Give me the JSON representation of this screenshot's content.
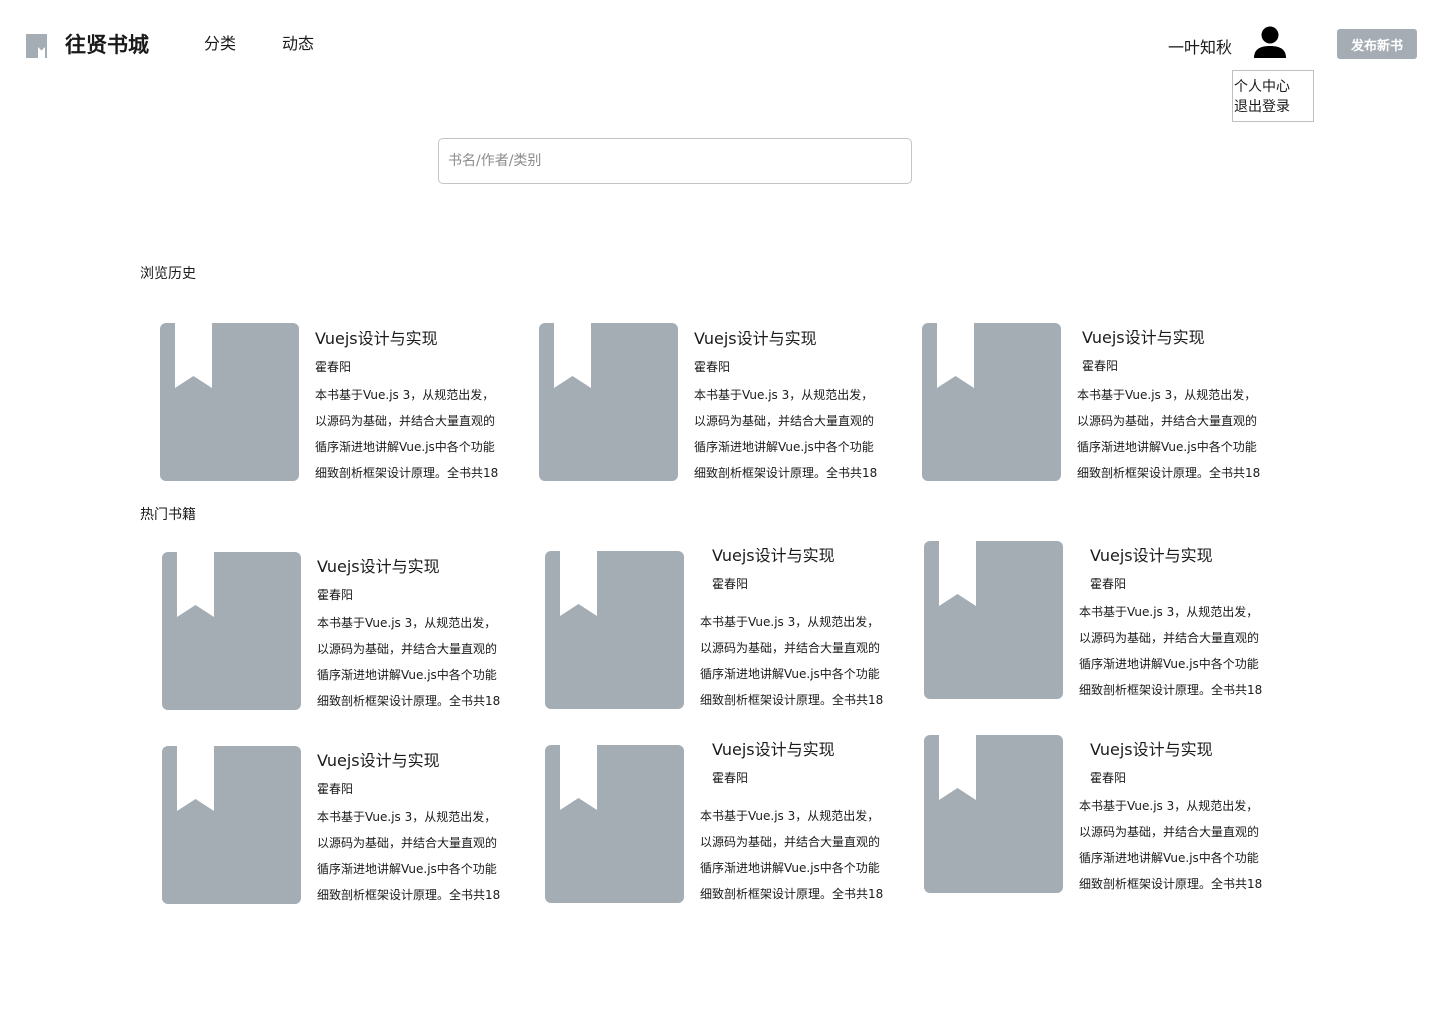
{
  "header": {
    "brand": "往贤书城",
    "logo_icon": "book-logo-icon",
    "nav": [
      "分类",
      "动态"
    ],
    "username": "一叶知秋",
    "avatar_icon": "user-icon",
    "publish_label": "发布新书"
  },
  "user_menu": {
    "items": [
      "个人中心",
      "退出登录"
    ]
  },
  "search": {
    "placeholder": "书名/作者/类别",
    "value": ""
  },
  "sections": {
    "history_title": "浏览历史",
    "hot_title": "热门书籍"
  },
  "history_books": [
    {
      "title": "Vuejs设计与实现",
      "author": "霍春阳",
      "desc": [
        "本书基于Vue.js 3，从规范出发，",
        "以源码为基础，并结合大量直观的",
        "循序渐进地讲解Vue.js中各个功能",
        "细致剖析框架设计原理。全书共18"
      ]
    },
    {
      "title": "Vuejs设计与实现",
      "author": "霍春阳",
      "desc": [
        "本书基于Vue.js 3，从规范出发，",
        "以源码为基础，并结合大量直观的",
        "循序渐进地讲解Vue.js中各个功能",
        "细致剖析框架设计原理。全书共18"
      ]
    },
    {
      "title": "Vuejs设计与实现",
      "author": "霍春阳",
      "desc": [
        "本书基于Vue.js 3，从规范出发，",
        "以源码为基础，并结合大量直观的",
        "循序渐进地讲解Vue.js中各个功能",
        "细致剖析框架设计原理。全书共18"
      ]
    }
  ],
  "hot_books": [
    {
      "title": "Vuejs设计与实现",
      "author": "霍春阳",
      "desc": [
        "本书基于Vue.js 3，从规范出发，",
        "以源码为基础，并结合大量直观的",
        "循序渐进地讲解Vue.js中各个功能",
        "细致剖析框架设计原理。全书共18"
      ]
    },
    {
      "title": "Vuejs设计与实现",
      "author": "霍春阳",
      "desc": [
        "本书基于Vue.js 3，从规范出发，",
        "以源码为基础，并结合大量直观的",
        "循序渐进地讲解Vue.js中各个功能",
        "细致剖析框架设计原理。全书共18"
      ]
    },
    {
      "title": "Vuejs设计与实现",
      "author": "霍春阳",
      "desc": [
        "本书基于Vue.js 3，从规范出发，",
        "以源码为基础，并结合大量直观的",
        "循序渐进地讲解Vue.js中各个功能",
        "细致剖析框架设计原理。全书共18"
      ]
    },
    {
      "title": "Vuejs设计与实现",
      "author": "霍春阳",
      "desc": [
        "本书基于Vue.js 3，从规范出发，",
        "以源码为基础，并结合大量直观的",
        "循序渐进地讲解Vue.js中各个功能",
        "细致剖析框架设计原理。全书共18"
      ]
    },
    {
      "title": "Vuejs设计与实现",
      "author": "霍春阳",
      "desc": [
        "本书基于Vue.js 3，从规范出发，",
        "以源码为基础，并结合大量直观的",
        "循序渐进地讲解Vue.js中各个功能",
        "细致剖析框架设计原理。全书共18"
      ]
    },
    {
      "title": "Vuejs设计与实现",
      "author": "霍春阳",
      "desc": [
        "本书基于Vue.js 3，从规范出发，",
        "以源码为基础，并结合大量直观的",
        "循序渐进地讲解Vue.js中各个功能",
        "细致剖析框架设计原理。全书共18"
      ]
    }
  ],
  "colors": {
    "cover": "#a4acb4",
    "button": "#a5acb4",
    "text": "#1a1a1a"
  }
}
